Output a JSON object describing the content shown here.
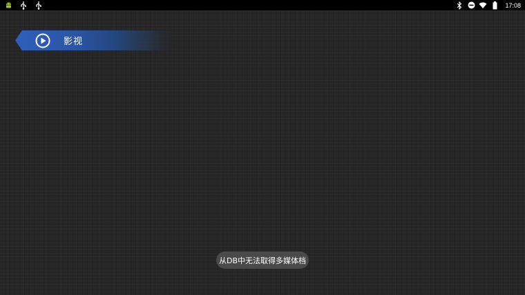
{
  "status_bar": {
    "left_icons": [
      "android-icon",
      "usb-icon",
      "usb-icon"
    ],
    "right_icons": [
      "bluetooth-icon",
      "do-not-disturb-icon",
      "wifi-icon",
      "battery-icon"
    ],
    "time": "17:08"
  },
  "category": {
    "icon": "play-icon",
    "label": "影视",
    "accent_color": "#2a5ab0"
  },
  "toast": {
    "message": "从DB中无法取得多媒体档"
  }
}
